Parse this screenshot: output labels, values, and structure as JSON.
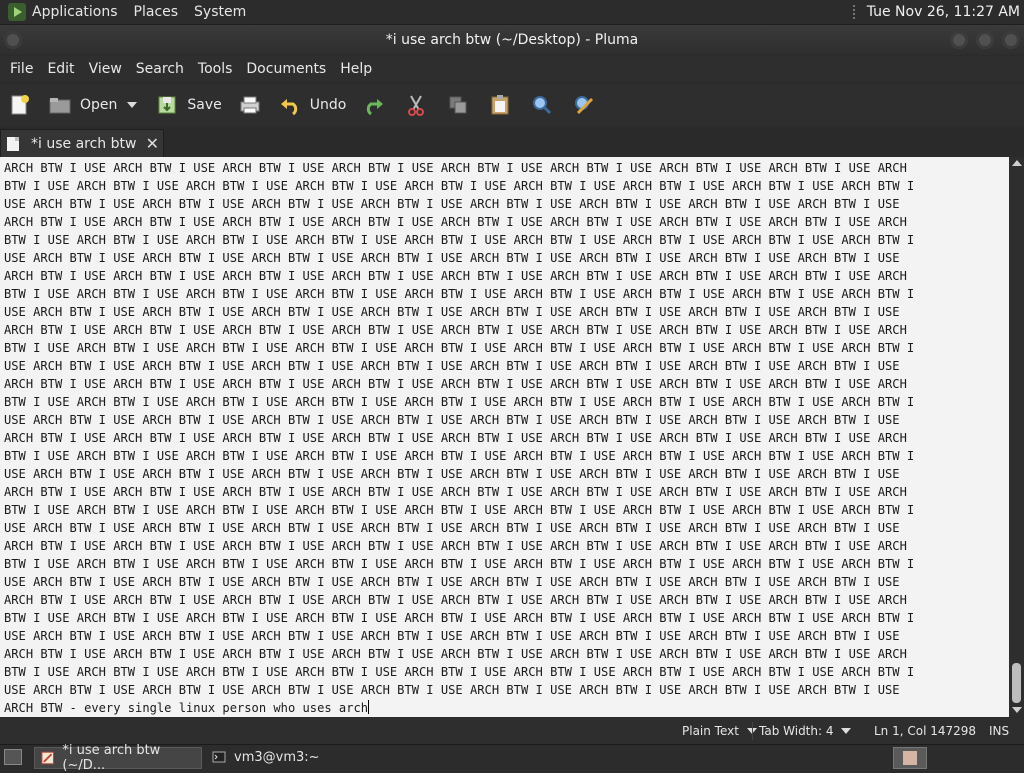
{
  "top_panel": {
    "menus": [
      "Applications",
      "Places",
      "System"
    ],
    "clock": "Tue Nov 26, 11:27 AM"
  },
  "window": {
    "title": "*i use arch btw (~/Desktop) - Pluma"
  },
  "menubar": {
    "items": [
      "File",
      "Edit",
      "View",
      "Search",
      "Tools",
      "Documents",
      "Help"
    ]
  },
  "toolbar": {
    "new_icon": "new-document-icon",
    "open_label": "Open",
    "save_label": "Save",
    "print_icon": "print-icon",
    "undo_label": "Undo",
    "redo_icon": "redo-icon",
    "cut_icon": "cut-icon",
    "copy_icon": "copy-icon",
    "paste_icon": "paste-icon",
    "find_icon": "find-icon",
    "replace_icon": "replace-icon"
  },
  "tab": {
    "label": "*i use arch btw",
    "close": "✕"
  },
  "editor": {
    "lines": [
      "ARCH BTW I USE ARCH BTW I USE ARCH BTW I USE ARCH BTW I USE ARCH BTW I USE ARCH BTW I USE ARCH BTW I USE ARCH BTW I USE ARCH",
      "BTW I USE ARCH BTW I USE ARCH BTW I USE ARCH BTW I USE ARCH BTW I USE ARCH BTW I USE ARCH BTW I USE ARCH BTW I USE ARCH BTW I",
      "USE ARCH BTW I USE ARCH BTW I USE ARCH BTW I USE ARCH BTW I USE ARCH BTW I USE ARCH BTW I USE ARCH BTW I USE ARCH BTW I USE",
      "ARCH BTW I USE ARCH BTW I USE ARCH BTW I USE ARCH BTW I USE ARCH BTW I USE ARCH BTW I USE ARCH BTW I USE ARCH BTW I USE ARCH",
      "BTW I USE ARCH BTW I USE ARCH BTW I USE ARCH BTW I USE ARCH BTW I USE ARCH BTW I USE ARCH BTW I USE ARCH BTW I USE ARCH BTW I",
      "USE ARCH BTW I USE ARCH BTW I USE ARCH BTW I USE ARCH BTW I USE ARCH BTW I USE ARCH BTW I USE ARCH BTW I USE ARCH BTW I USE",
      "ARCH BTW I USE ARCH BTW I USE ARCH BTW I USE ARCH BTW I USE ARCH BTW I USE ARCH BTW I USE ARCH BTW I USE ARCH BTW I USE ARCH",
      "BTW I USE ARCH BTW I USE ARCH BTW I USE ARCH BTW I USE ARCH BTW I USE ARCH BTW I USE ARCH BTW I USE ARCH BTW I USE ARCH BTW I",
      "USE ARCH BTW I USE ARCH BTW I USE ARCH BTW I USE ARCH BTW I USE ARCH BTW I USE ARCH BTW I USE ARCH BTW I USE ARCH BTW I USE",
      "ARCH BTW I USE ARCH BTW I USE ARCH BTW I USE ARCH BTW I USE ARCH BTW I USE ARCH BTW I USE ARCH BTW I USE ARCH BTW I USE ARCH",
      "BTW I USE ARCH BTW I USE ARCH BTW I USE ARCH BTW I USE ARCH BTW I USE ARCH BTW I USE ARCH BTW I USE ARCH BTW I USE ARCH BTW I",
      "USE ARCH BTW I USE ARCH BTW I USE ARCH BTW I USE ARCH BTW I USE ARCH BTW I USE ARCH BTW I USE ARCH BTW I USE ARCH BTW I USE",
      "ARCH BTW I USE ARCH BTW I USE ARCH BTW I USE ARCH BTW I USE ARCH BTW I USE ARCH BTW I USE ARCH BTW I USE ARCH BTW I USE ARCH",
      "BTW I USE ARCH BTW I USE ARCH BTW I USE ARCH BTW I USE ARCH BTW I USE ARCH BTW I USE ARCH BTW I USE ARCH BTW I USE ARCH BTW I",
      "USE ARCH BTW I USE ARCH BTW I USE ARCH BTW I USE ARCH BTW I USE ARCH BTW I USE ARCH BTW I USE ARCH BTW I USE ARCH BTW I USE",
      "ARCH BTW I USE ARCH BTW I USE ARCH BTW I USE ARCH BTW I USE ARCH BTW I USE ARCH BTW I USE ARCH BTW I USE ARCH BTW I USE ARCH",
      "BTW I USE ARCH BTW I USE ARCH BTW I USE ARCH BTW I USE ARCH BTW I USE ARCH BTW I USE ARCH BTW I USE ARCH BTW I USE ARCH BTW I",
      "USE ARCH BTW I USE ARCH BTW I USE ARCH BTW I USE ARCH BTW I USE ARCH BTW I USE ARCH BTW I USE ARCH BTW I USE ARCH BTW I USE",
      "ARCH BTW I USE ARCH BTW I USE ARCH BTW I USE ARCH BTW I USE ARCH BTW I USE ARCH BTW I USE ARCH BTW I USE ARCH BTW I USE ARCH",
      "BTW I USE ARCH BTW I USE ARCH BTW I USE ARCH BTW I USE ARCH BTW I USE ARCH BTW I USE ARCH BTW I USE ARCH BTW I USE ARCH BTW I",
      "USE ARCH BTW I USE ARCH BTW I USE ARCH BTW I USE ARCH BTW I USE ARCH BTW I USE ARCH BTW I USE ARCH BTW I USE ARCH BTW I USE",
      "ARCH BTW I USE ARCH BTW I USE ARCH BTW I USE ARCH BTW I USE ARCH BTW I USE ARCH BTW I USE ARCH BTW I USE ARCH BTW I USE ARCH",
      "BTW I USE ARCH BTW I USE ARCH BTW I USE ARCH BTW I USE ARCH BTW I USE ARCH BTW I USE ARCH BTW I USE ARCH BTW I USE ARCH BTW I",
      "USE ARCH BTW I USE ARCH BTW I USE ARCH BTW I USE ARCH BTW I USE ARCH BTW I USE ARCH BTW I USE ARCH BTW I USE ARCH BTW I USE",
      "ARCH BTW I USE ARCH BTW I USE ARCH BTW I USE ARCH BTW I USE ARCH BTW I USE ARCH BTW I USE ARCH BTW I USE ARCH BTW I USE ARCH",
      "BTW I USE ARCH BTW I USE ARCH BTW I USE ARCH BTW I USE ARCH BTW I USE ARCH BTW I USE ARCH BTW I USE ARCH BTW I USE ARCH BTW I",
      "USE ARCH BTW I USE ARCH BTW I USE ARCH BTW I USE ARCH BTW I USE ARCH BTW I USE ARCH BTW I USE ARCH BTW I USE ARCH BTW I USE",
      "ARCH BTW I USE ARCH BTW I USE ARCH BTW I USE ARCH BTW I USE ARCH BTW I USE ARCH BTW I USE ARCH BTW I USE ARCH BTW I USE ARCH",
      "BTW I USE ARCH BTW I USE ARCH BTW I USE ARCH BTW I USE ARCH BTW I USE ARCH BTW I USE ARCH BTW I USE ARCH BTW I USE ARCH BTW I",
      "USE ARCH BTW I USE ARCH BTW I USE ARCH BTW I USE ARCH BTW I USE ARCH BTW I USE ARCH BTW I USE ARCH BTW I USE ARCH BTW I USE",
      "ARCH BTW - every single linux person who uses arch"
    ]
  },
  "statusbar": {
    "language": "Plain Text",
    "tab_width": "Tab Width: 4",
    "position": "Ln 1, Col 147298",
    "mode": "INS"
  },
  "bottom_panel": {
    "tasks": [
      {
        "label": "*i use arch btw (~/D...",
        "icon": "text-editor-icon"
      },
      {
        "label": "vm3@vm3:~",
        "icon": "terminal-icon"
      }
    ]
  },
  "colors": {
    "panel_bg": "#2c2c2c",
    "editor_bg": "#f3f3f3",
    "accent": "#9fd37a"
  }
}
